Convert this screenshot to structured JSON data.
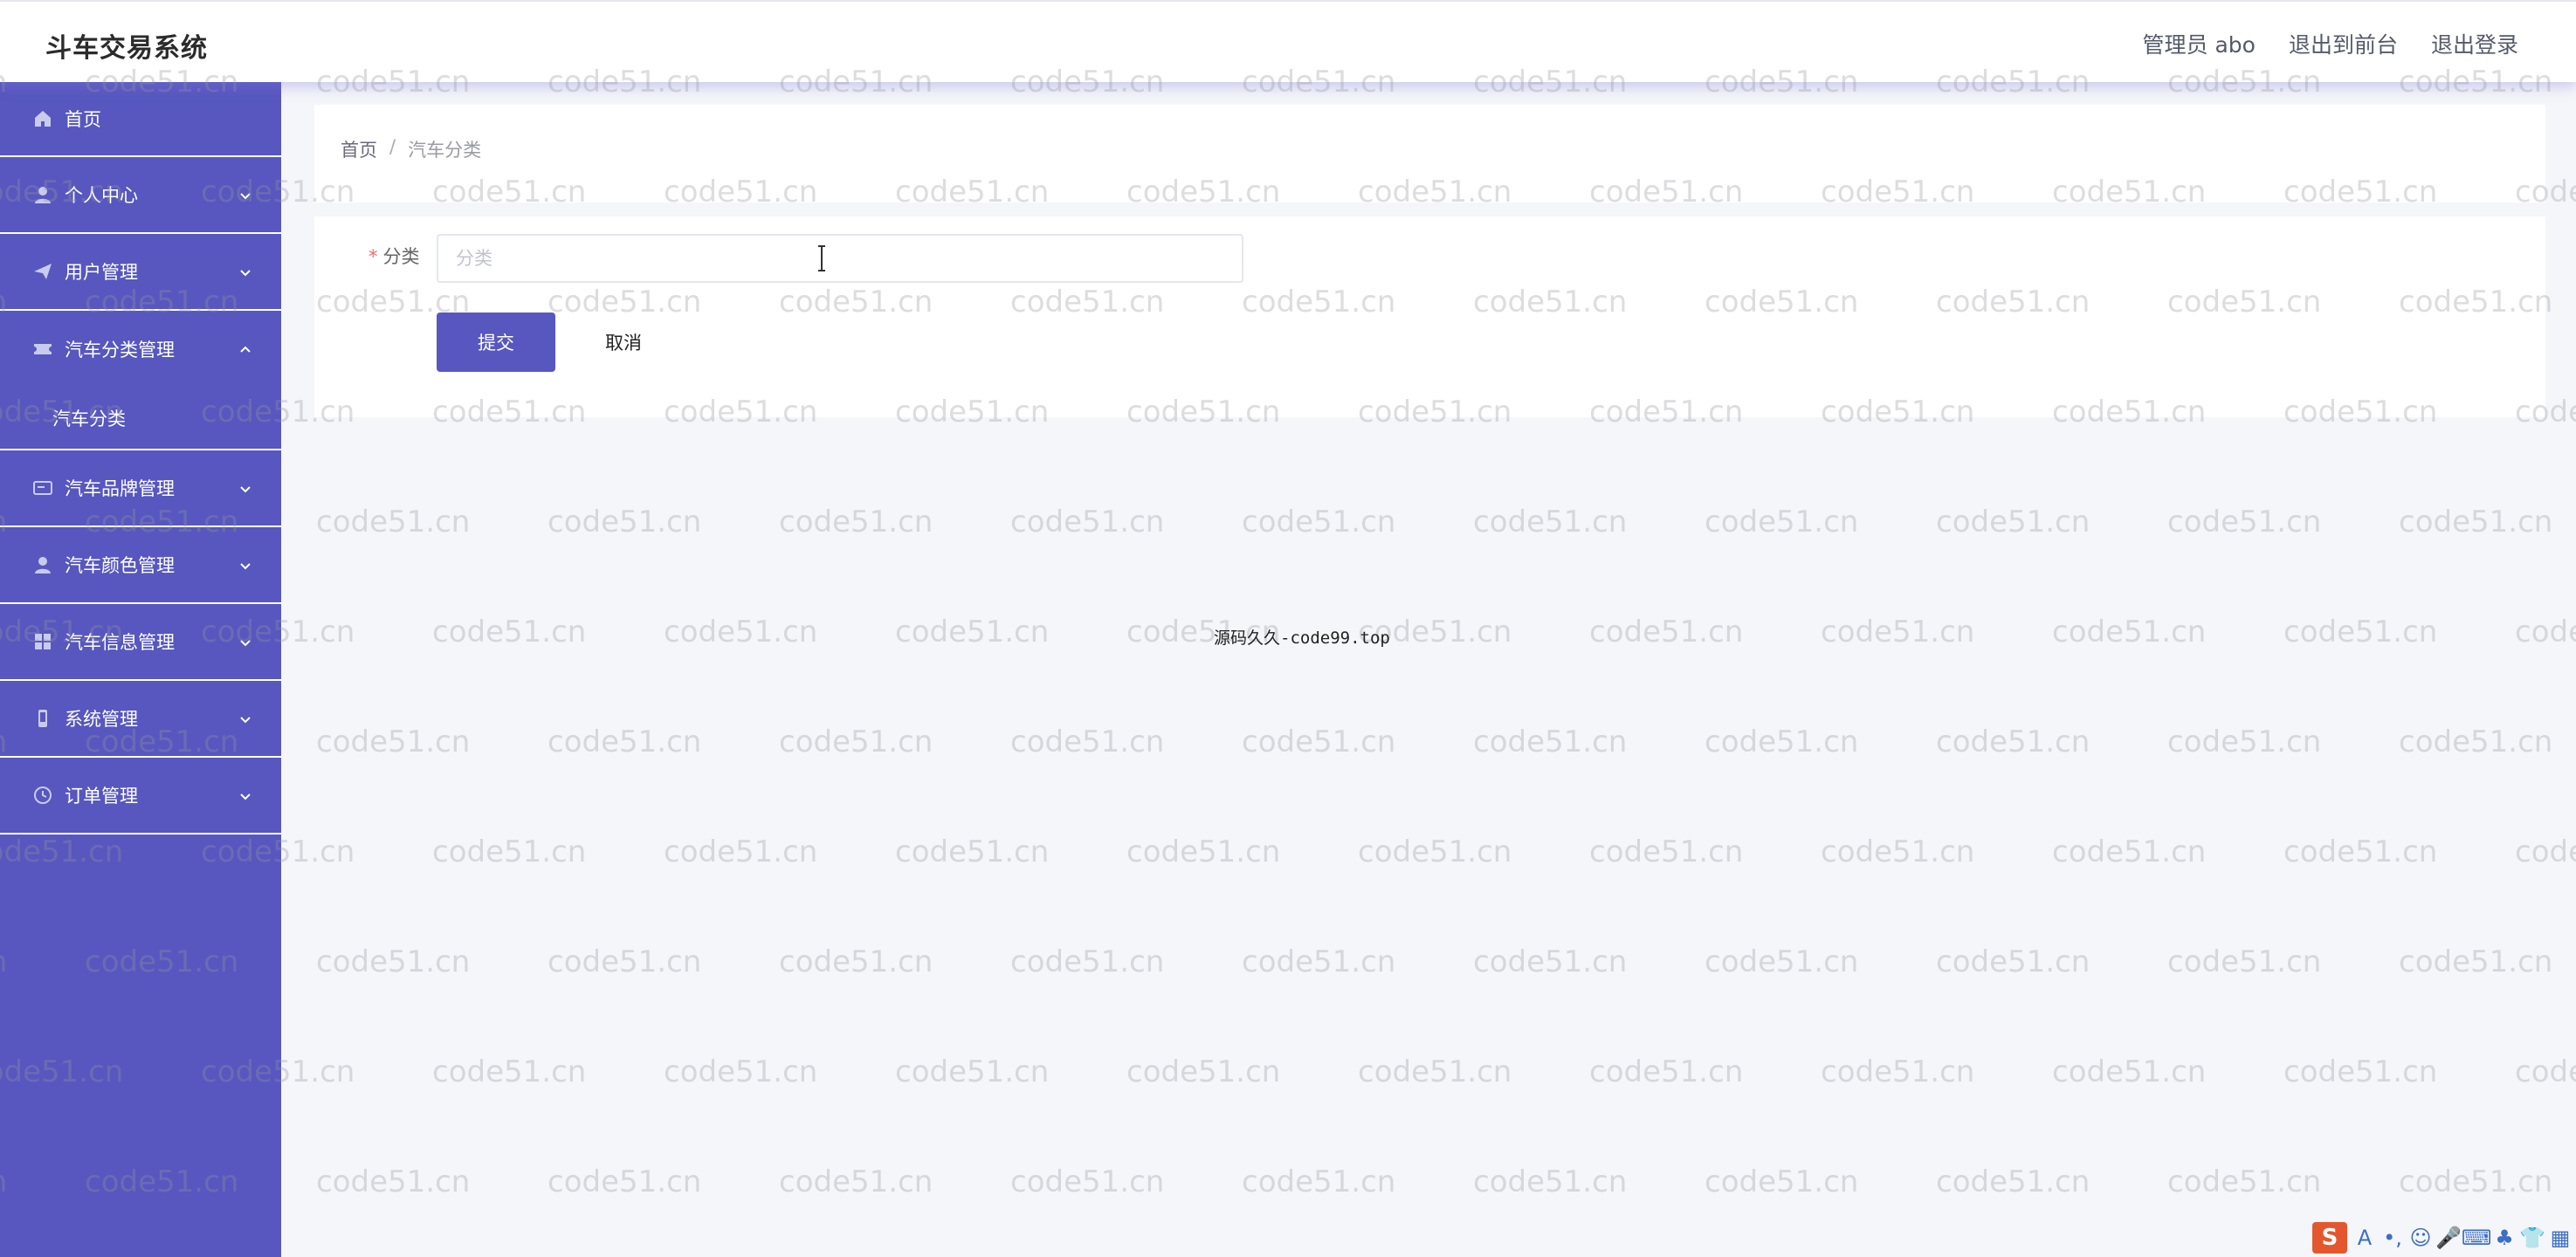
{
  "app": {
    "title": "斗车交易系统"
  },
  "header": {
    "user_label": "管理员 abo",
    "to_frontend": "退出到前台",
    "logout": "退出登录"
  },
  "sidebar": {
    "items": [
      {
        "label": "首页",
        "icon": "home-icon"
      },
      {
        "label": "个人中心",
        "icon": "user-icon"
      },
      {
        "label": "用户管理",
        "icon": "send-icon"
      },
      {
        "label": "汽车分类管理",
        "icon": "ticket-icon"
      },
      {
        "label": "汽车品牌管理",
        "icon": "card-icon"
      },
      {
        "label": "汽车颜色管理",
        "icon": "user-icon"
      },
      {
        "label": "汽车信息管理",
        "icon": "grid-icon"
      },
      {
        "label": "系统管理",
        "icon": "phone-icon"
      },
      {
        "label": "订单管理",
        "icon": "clock-icon"
      }
    ],
    "submenu": {
      "label": "汽车分类"
    }
  },
  "breadcrumb": {
    "home": "首页",
    "separator": "/",
    "current": "汽车分类"
  },
  "form": {
    "field_label": "分类",
    "required_mark": "*",
    "placeholder": "分类",
    "submit": "提交",
    "cancel": "取消"
  },
  "watermark": {
    "text": "code51.cn",
    "center_note": "源码久久-code99.top"
  },
  "colors": {
    "accent": "#5757bf",
    "sidebar_bg": "#5757bf",
    "page_bg": "#f5f6f9"
  },
  "ime_toolbar": {
    "logo": "S",
    "icons": [
      "A",
      "•,",
      "☺",
      "🎤",
      "⌨",
      "♣",
      "👕",
      "▦"
    ]
  }
}
